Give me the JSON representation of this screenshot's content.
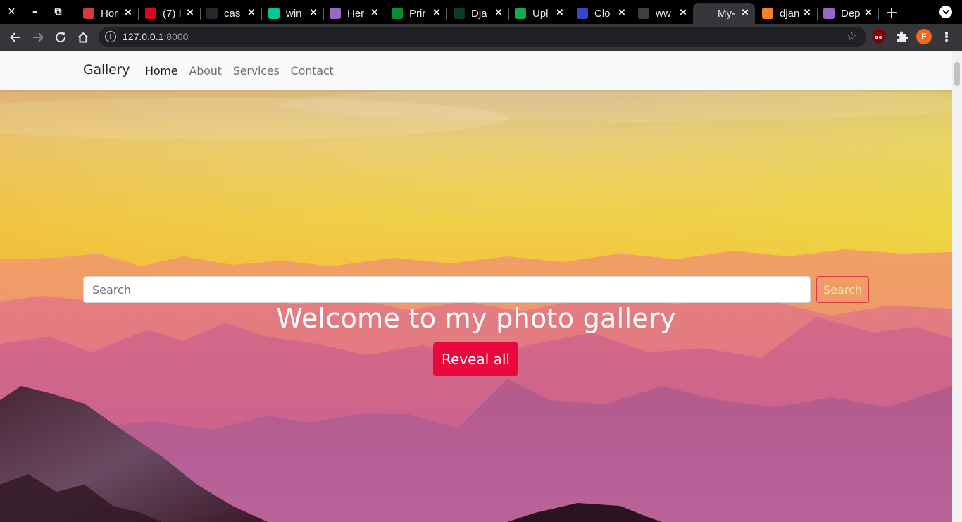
{
  "browser": {
    "window_buttons": {
      "close": "✕",
      "minimize": "–",
      "restore": "⧉"
    },
    "tabs": [
      {
        "title": "Hor",
        "icon": "pocket-icon",
        "color": "#d33a3a"
      },
      {
        "title": "(7) I",
        "icon": "pinterest-icon",
        "color": "#e60023"
      },
      {
        "title": "cas",
        "icon": "github-icon",
        "color": "#24292e"
      },
      {
        "title": "win",
        "icon": "lightning-icon",
        "color": "#00c896"
      },
      {
        "title": "Her",
        "icon": "heroku-icon",
        "color": "#9a67c7"
      },
      {
        "title": "Prir",
        "icon": "printful-icon",
        "color": "#0d8a3a"
      },
      {
        "title": "Dja",
        "icon": "django-icon",
        "color": "#0c3c26"
      },
      {
        "title": "Upl",
        "icon": "mongodb-icon",
        "color": "#13aa52"
      },
      {
        "title": "Clo",
        "icon": "cloudinary-icon",
        "color": "#3448c5"
      },
      {
        "title": "ww",
        "icon": "play-icon",
        "color": "#3c4043"
      },
      {
        "title": "My-",
        "icon": "globe-icon",
        "color": "#35363a"
      },
      {
        "title": "djan",
        "icon": "stackoverflow-icon",
        "color": "#f48024"
      },
      {
        "title": "Dep",
        "icon": "heroku-icon",
        "color": "#9a67c7"
      }
    ],
    "active_tab_index": 10,
    "new_tab": "+",
    "url_host": "127.0.0.1",
    "url_port": ":8000",
    "info_icon_glyph": "i",
    "extension_ublock": "uo",
    "profile_initial": "E"
  },
  "page": {
    "brand": "Gallery",
    "nav": [
      {
        "label": "Home",
        "active": true
      },
      {
        "label": "About",
        "active": false
      },
      {
        "label": "Services",
        "active": false
      },
      {
        "label": "Contact",
        "active": false
      }
    ],
    "search": {
      "placeholder": "Search",
      "button": "Search"
    },
    "hero_title": "Welcome to my photo gallery",
    "cta": "Reveal all"
  },
  "colors": {
    "navbar_bg": "#f8f9fa",
    "search_btn_border": "#dc3545",
    "cta_bg": "#e8083e",
    "sky_top": "#e8c060",
    "sky_mid": "#f0d040",
    "mountain_far": "#e89070",
    "mountain_mid": "#d86a80",
    "mountain_near": "#b05a8a",
    "foreground_rock": "#3a1e2a"
  }
}
